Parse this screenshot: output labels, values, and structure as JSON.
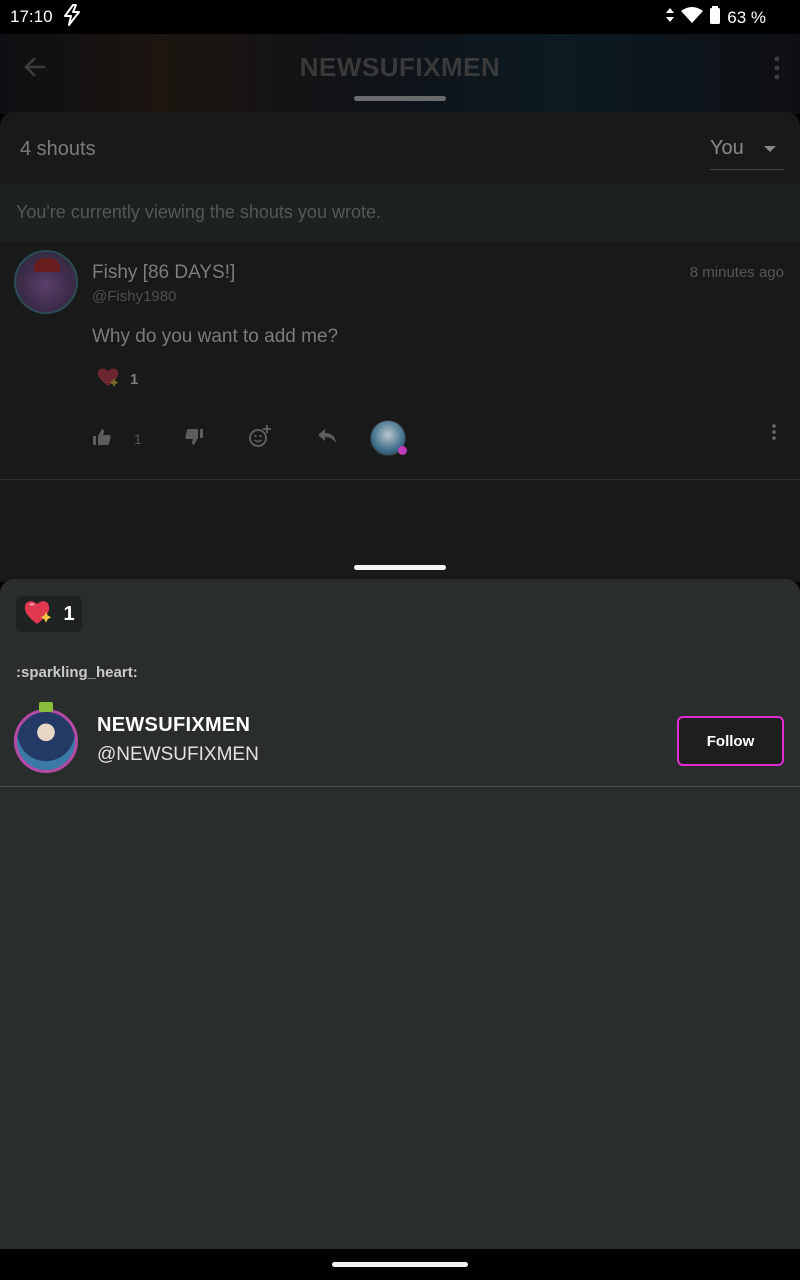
{
  "status_bar": {
    "time": "17:10",
    "battery": "63 %",
    "icons": [
      "bolt-icon",
      "data-arrows-icon",
      "wifi-icon",
      "battery-icon"
    ]
  },
  "app_bar": {
    "title": "NEWSUFIXMEN",
    "back_icon": "arrow-back-icon",
    "more_icon": "more-vert-icon"
  },
  "shouts": {
    "count_label": "4 shouts",
    "filter": {
      "selected": "You"
    },
    "info": "You're currently viewing the shouts you wrote.",
    "items": [
      {
        "author_name": "Fishy [86 DAYS!]",
        "author_handle": "@Fishy1980",
        "time": "8 minutes ago",
        "text": "Why do you want to add me?",
        "reaction_count": "1",
        "upvote_count": "1"
      }
    ]
  },
  "reactions_sheet": {
    "chip_count": "1",
    "emoji_code": ":sparkling_heart:",
    "user": {
      "name": "NEWSUFIXMEN",
      "handle": "@NEWSUFIXMEN",
      "follow_label": "Follow"
    }
  },
  "colors": {
    "accent": "#e22bd6",
    "sheet_bg": "#292e2c",
    "heart": "#e0384f"
  }
}
